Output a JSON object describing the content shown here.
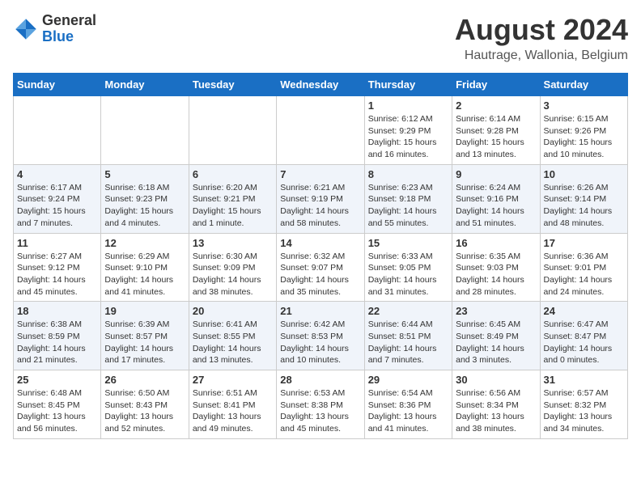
{
  "logo": {
    "line1": "General",
    "line2": "Blue"
  },
  "title": {
    "month_year": "August 2024",
    "location": "Hautrage, Wallonia, Belgium"
  },
  "weekdays": [
    "Sunday",
    "Monday",
    "Tuesday",
    "Wednesday",
    "Thursday",
    "Friday",
    "Saturday"
  ],
  "weeks": [
    [
      {
        "day": "",
        "info": ""
      },
      {
        "day": "",
        "info": ""
      },
      {
        "day": "",
        "info": ""
      },
      {
        "day": "",
        "info": ""
      },
      {
        "day": "1",
        "info": "Sunrise: 6:12 AM\nSunset: 9:29 PM\nDaylight: 15 hours and 16 minutes."
      },
      {
        "day": "2",
        "info": "Sunrise: 6:14 AM\nSunset: 9:28 PM\nDaylight: 15 hours and 13 minutes."
      },
      {
        "day": "3",
        "info": "Sunrise: 6:15 AM\nSunset: 9:26 PM\nDaylight: 15 hours and 10 minutes."
      }
    ],
    [
      {
        "day": "4",
        "info": "Sunrise: 6:17 AM\nSunset: 9:24 PM\nDaylight: 15 hours and 7 minutes."
      },
      {
        "day": "5",
        "info": "Sunrise: 6:18 AM\nSunset: 9:23 PM\nDaylight: 15 hours and 4 minutes."
      },
      {
        "day": "6",
        "info": "Sunrise: 6:20 AM\nSunset: 9:21 PM\nDaylight: 15 hours and 1 minute."
      },
      {
        "day": "7",
        "info": "Sunrise: 6:21 AM\nSunset: 9:19 PM\nDaylight: 14 hours and 58 minutes."
      },
      {
        "day": "8",
        "info": "Sunrise: 6:23 AM\nSunset: 9:18 PM\nDaylight: 14 hours and 55 minutes."
      },
      {
        "day": "9",
        "info": "Sunrise: 6:24 AM\nSunset: 9:16 PM\nDaylight: 14 hours and 51 minutes."
      },
      {
        "day": "10",
        "info": "Sunrise: 6:26 AM\nSunset: 9:14 PM\nDaylight: 14 hours and 48 minutes."
      }
    ],
    [
      {
        "day": "11",
        "info": "Sunrise: 6:27 AM\nSunset: 9:12 PM\nDaylight: 14 hours and 45 minutes."
      },
      {
        "day": "12",
        "info": "Sunrise: 6:29 AM\nSunset: 9:10 PM\nDaylight: 14 hours and 41 minutes."
      },
      {
        "day": "13",
        "info": "Sunrise: 6:30 AM\nSunset: 9:09 PM\nDaylight: 14 hours and 38 minutes."
      },
      {
        "day": "14",
        "info": "Sunrise: 6:32 AM\nSunset: 9:07 PM\nDaylight: 14 hours and 35 minutes."
      },
      {
        "day": "15",
        "info": "Sunrise: 6:33 AM\nSunset: 9:05 PM\nDaylight: 14 hours and 31 minutes."
      },
      {
        "day": "16",
        "info": "Sunrise: 6:35 AM\nSunset: 9:03 PM\nDaylight: 14 hours and 28 minutes."
      },
      {
        "day": "17",
        "info": "Sunrise: 6:36 AM\nSunset: 9:01 PM\nDaylight: 14 hours and 24 minutes."
      }
    ],
    [
      {
        "day": "18",
        "info": "Sunrise: 6:38 AM\nSunset: 8:59 PM\nDaylight: 14 hours and 21 minutes."
      },
      {
        "day": "19",
        "info": "Sunrise: 6:39 AM\nSunset: 8:57 PM\nDaylight: 14 hours and 17 minutes."
      },
      {
        "day": "20",
        "info": "Sunrise: 6:41 AM\nSunset: 8:55 PM\nDaylight: 14 hours and 13 minutes."
      },
      {
        "day": "21",
        "info": "Sunrise: 6:42 AM\nSunset: 8:53 PM\nDaylight: 14 hours and 10 minutes."
      },
      {
        "day": "22",
        "info": "Sunrise: 6:44 AM\nSunset: 8:51 PM\nDaylight: 14 hours and 7 minutes."
      },
      {
        "day": "23",
        "info": "Sunrise: 6:45 AM\nSunset: 8:49 PM\nDaylight: 14 hours and 3 minutes."
      },
      {
        "day": "24",
        "info": "Sunrise: 6:47 AM\nSunset: 8:47 PM\nDaylight: 14 hours and 0 minutes."
      }
    ],
    [
      {
        "day": "25",
        "info": "Sunrise: 6:48 AM\nSunset: 8:45 PM\nDaylight: 13 hours and 56 minutes."
      },
      {
        "day": "26",
        "info": "Sunrise: 6:50 AM\nSunset: 8:43 PM\nDaylight: 13 hours and 52 minutes."
      },
      {
        "day": "27",
        "info": "Sunrise: 6:51 AM\nSunset: 8:41 PM\nDaylight: 13 hours and 49 minutes."
      },
      {
        "day": "28",
        "info": "Sunrise: 6:53 AM\nSunset: 8:38 PM\nDaylight: 13 hours and 45 minutes."
      },
      {
        "day": "29",
        "info": "Sunrise: 6:54 AM\nSunset: 8:36 PM\nDaylight: 13 hours and 41 minutes."
      },
      {
        "day": "30",
        "info": "Sunrise: 6:56 AM\nSunset: 8:34 PM\nDaylight: 13 hours and 38 minutes."
      },
      {
        "day": "31",
        "info": "Sunrise: 6:57 AM\nSunset: 8:32 PM\nDaylight: 13 hours and 34 minutes."
      }
    ]
  ]
}
